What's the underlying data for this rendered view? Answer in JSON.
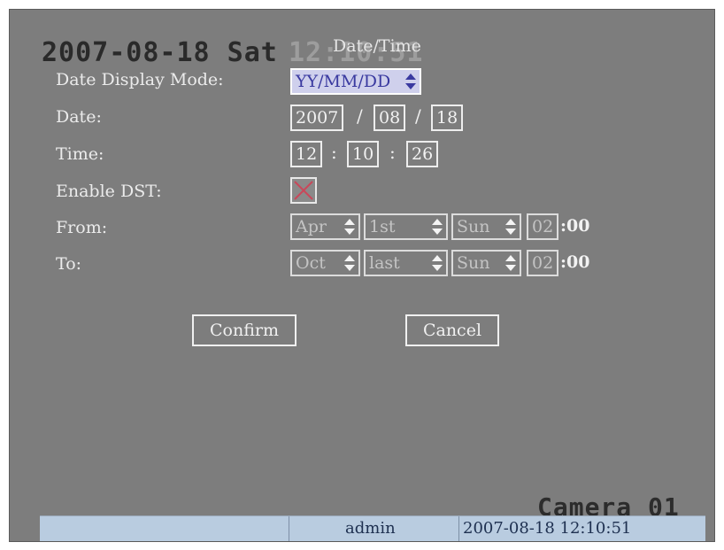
{
  "osd": {
    "date_prefix": "2007-08-18 Sat",
    "time_overlay": "12:10:51",
    "camera": "Camera 01"
  },
  "dialog": {
    "title": "Date/Time",
    "date_mode_label": "Date Display Mode:",
    "date_mode_value": "YY/MM/DD",
    "date_label": "Date:",
    "date": {
      "year": "2007",
      "month": "08",
      "day": "18",
      "sep": "/"
    },
    "time_label": "Time:",
    "time": {
      "hour": "12",
      "minute": "10",
      "second": "26",
      "sep": ":"
    },
    "dst_label": "Enable DST:",
    "dst_enabled": false,
    "from_label": "From:",
    "from": {
      "month": "Apr",
      "week": "1st",
      "day": "Sun",
      "hour": "02",
      "minute_suffix": ":00"
    },
    "to_label": "To:",
    "to": {
      "month": "Oct",
      "week": "last",
      "day": "Sun",
      "hour": "02",
      "minute_suffix": ":00"
    },
    "confirm_label": "Confirm",
    "cancel_label": "Cancel"
  },
  "statusbar": {
    "user": "admin",
    "datetime": "2007-08-18 12:10:51"
  },
  "colors": {
    "background": "#7d7d7d",
    "statusbar": "#b9cce0",
    "highlight": "#cfd0ec",
    "dst_cross": "#c9485a"
  }
}
